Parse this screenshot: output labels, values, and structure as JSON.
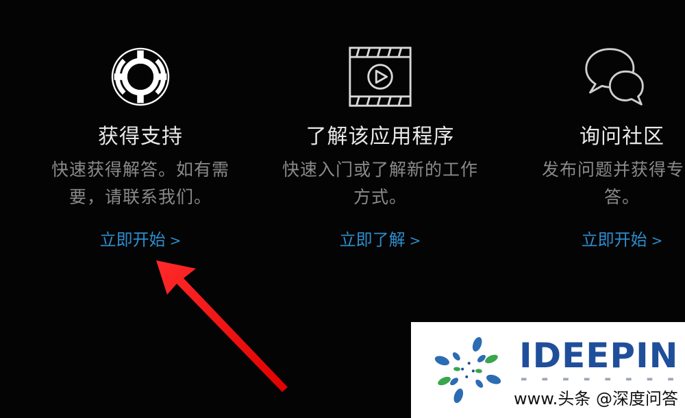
{
  "cards": [
    {
      "title": "获得支持",
      "desc_line1": "快速获得解答。如有需",
      "desc_line2": "要，请联系我们。",
      "link": "立即开始",
      "icon": "lifebuoy-icon"
    },
    {
      "title": "了解该应用程序",
      "desc_line1": "快速入门或了解新的工作",
      "desc_line2": "方式。",
      "link": "立即了解",
      "icon": "video-film-icon"
    },
    {
      "title": "询问社区",
      "desc_line1": "发布问题并获得专家",
      "desc_line2": "答。",
      "link": "立即开始",
      "icon": "speech-bubbles-icon"
    }
  ],
  "link_chevron": ">",
  "watermark": {
    "brand": "IDEEPIN",
    "site": "www.头条 @深度问答"
  },
  "colors": {
    "background": "#040404",
    "title_text": "#e8e8e8",
    "desc_text": "#8a8a8a",
    "link": "#2d8ecf",
    "arrow": "#ff1a1a",
    "brand": "#1f4f9a"
  }
}
